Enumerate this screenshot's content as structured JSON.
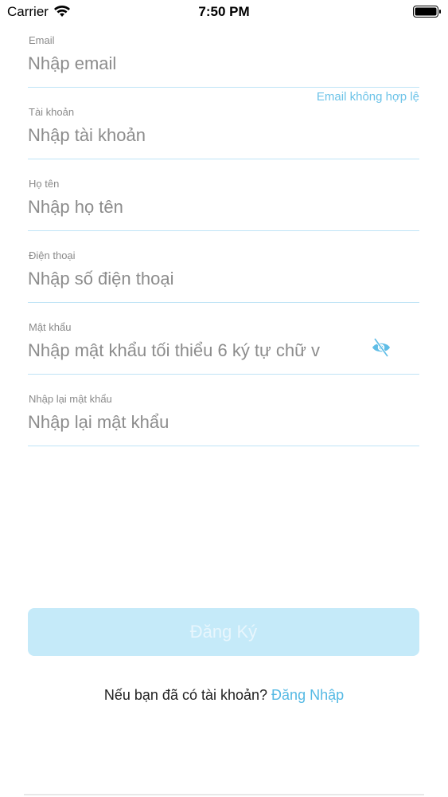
{
  "status_bar": {
    "carrier": "Carrier",
    "time": "7:50 PM"
  },
  "form": {
    "email": {
      "label": "Email",
      "placeholder": "Nhập email",
      "value": "",
      "error": "Email không hợp lệ"
    },
    "account": {
      "label": "Tài khoản",
      "placeholder": "Nhập tài khoản",
      "value": ""
    },
    "full_name": {
      "label": "Họ tên",
      "placeholder": "Nhập họ tên",
      "value": ""
    },
    "phone": {
      "label": "Điện thoại",
      "placeholder": "Nhập số điện thoại",
      "value": ""
    },
    "password": {
      "label": "Mật khẩu",
      "placeholder": "Nhập mật khẩu tối thiểu 6 ký tự chữ v",
      "value": ""
    },
    "confirm_password": {
      "label": "Nhập lại mật khẩu",
      "placeholder": "Nhập lại mật khẩu",
      "value": ""
    }
  },
  "register_button": {
    "label": "Đăng Ký"
  },
  "login_prompt": {
    "text": "Nếu bạn đã có tài khoản?",
    "link": "Đăng Nhập"
  },
  "colors": {
    "accent": "#55b9e4",
    "button_disabled_bg": "#c5eaf9",
    "underline": "#bfe4f6"
  },
  "icons": {
    "wifi": "wifi-icon",
    "battery": "battery-icon",
    "password_toggle": "eye-slash-icon"
  }
}
